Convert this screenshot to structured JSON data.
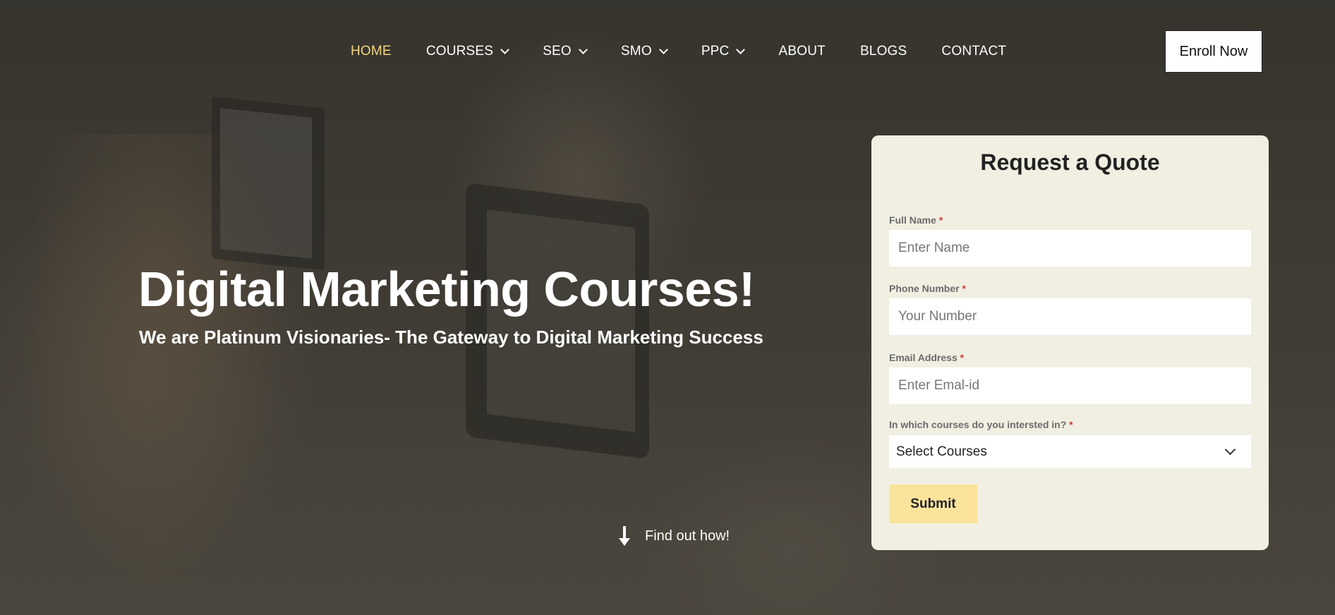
{
  "nav": {
    "items": [
      {
        "label": "HOME",
        "active": true,
        "dropdown": false
      },
      {
        "label": "COURSES",
        "active": false,
        "dropdown": true
      },
      {
        "label": "SEO",
        "active": false,
        "dropdown": true
      },
      {
        "label": "SMO",
        "active": false,
        "dropdown": true
      },
      {
        "label": "PPC",
        "active": false,
        "dropdown": true
      },
      {
        "label": "ABOUT",
        "active": false,
        "dropdown": false
      },
      {
        "label": "BLOGS",
        "active": false,
        "dropdown": false
      },
      {
        "label": "CONTACT",
        "active": false,
        "dropdown": false
      }
    ],
    "enroll_label": "Enroll Now"
  },
  "hero": {
    "title": "Digital Marketing Courses!",
    "subtitle": "We are Platinum Visionaries- The Gateway to Digital Marketing Success",
    "find_out": "Find out how!"
  },
  "quote_form": {
    "title": "Request a Quote",
    "fields": {
      "full_name": {
        "label": "Full Name",
        "placeholder": "Enter Name",
        "required_mark": "*"
      },
      "phone": {
        "label": "Phone Number",
        "placeholder": "Your Number",
        "required_mark": "*"
      },
      "email": {
        "label": "Email Address",
        "placeholder": "Enter Emal-id",
        "required_mark": "*"
      },
      "courses": {
        "label": "In which courses do you intersted in?",
        "selected": "Select Courses",
        "required_mark": "*"
      }
    },
    "submit_label": "Submit"
  },
  "colors": {
    "nav_active": "#f3d77e",
    "card_bg": "#f1efe2",
    "submit_bg": "#fbe39c",
    "required": "#d23b3b"
  },
  "icons": {
    "dropdown": "chevron-down-icon",
    "find_out": "arrow-down-icon",
    "select": "chevron-down-icon"
  }
}
